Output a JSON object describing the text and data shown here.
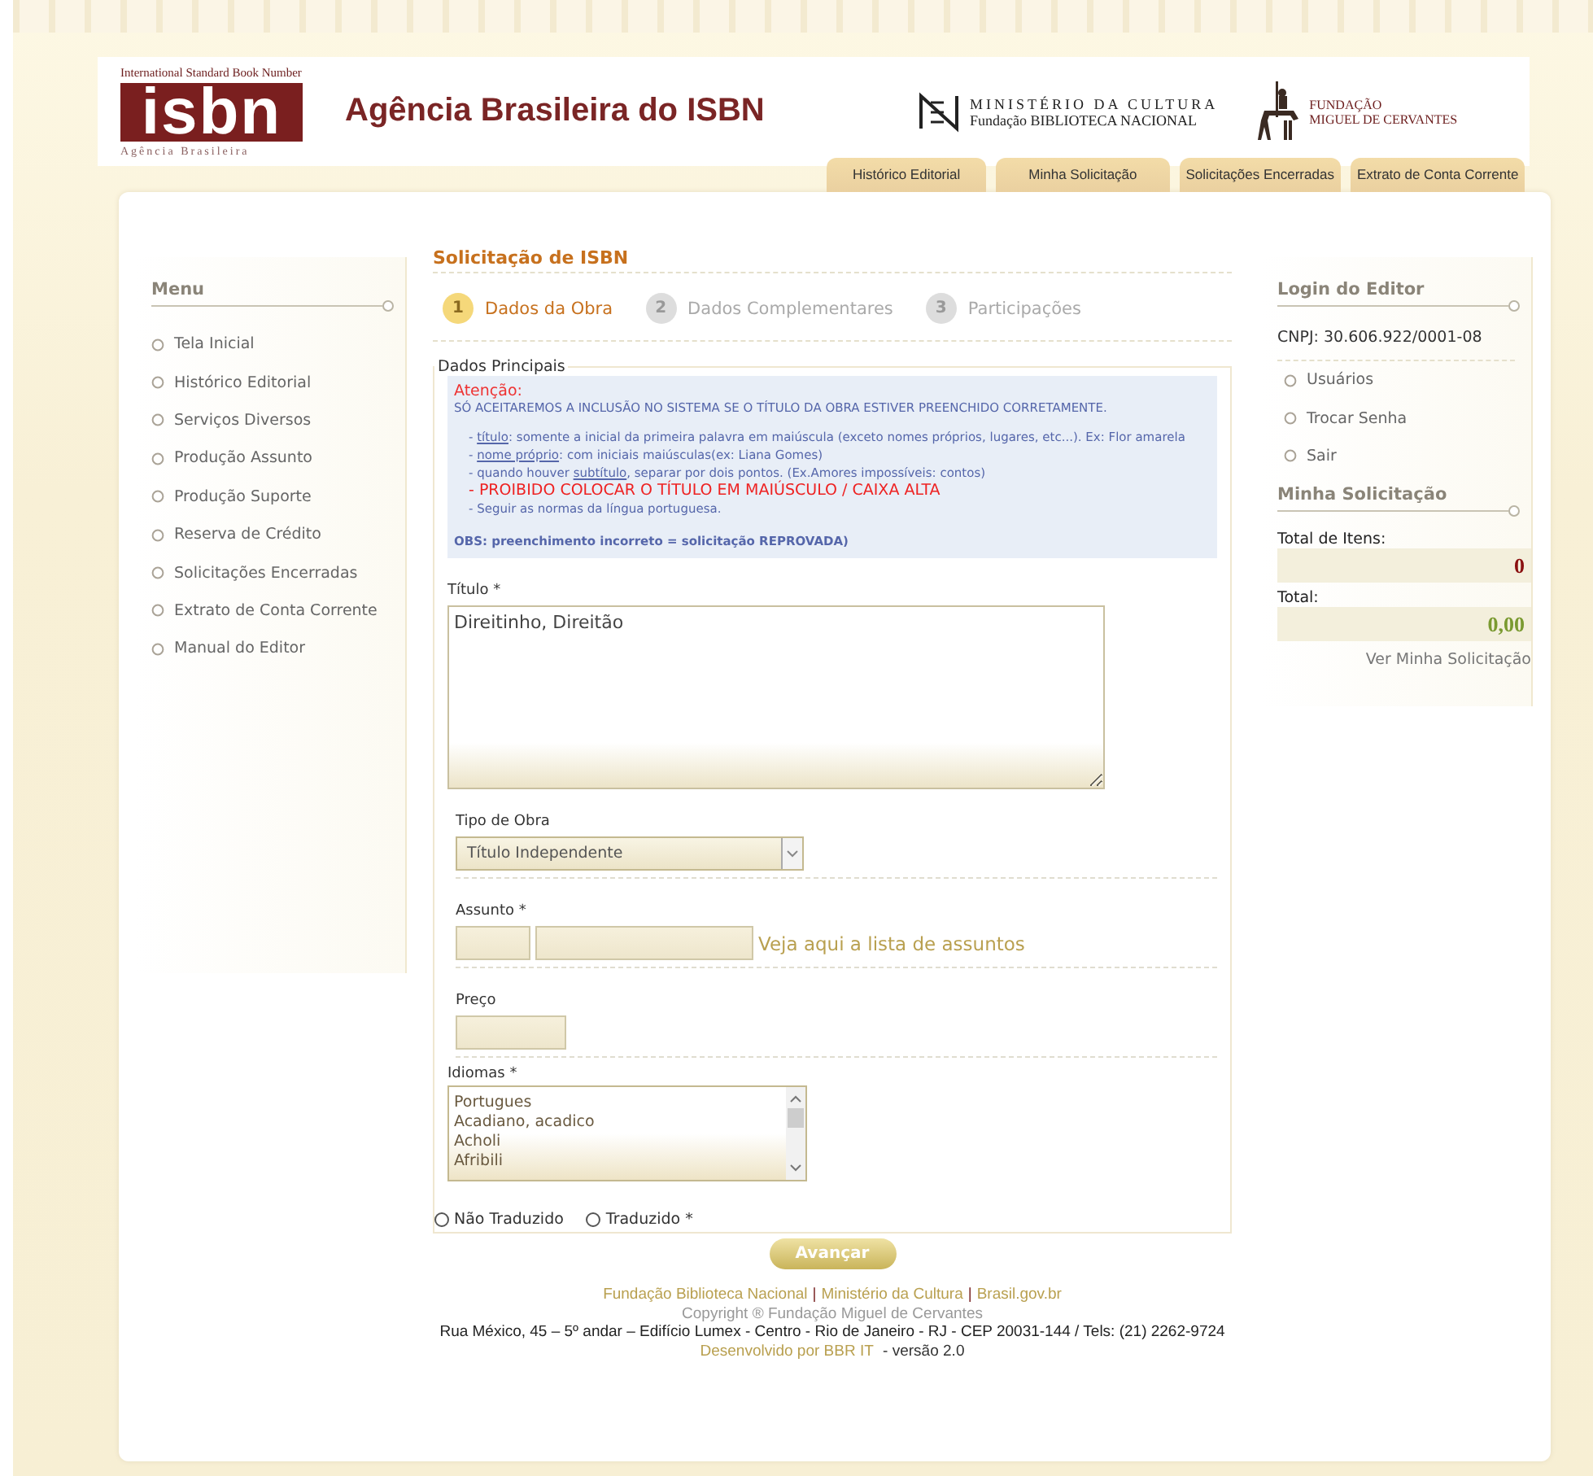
{
  "header": {
    "logo_top": "International Standard Book Number",
    "logo_mark": "isbn",
    "logo_bottom": "Agência Brasileira",
    "title": "Agência Brasileira do ISBN",
    "ministry_line1": "MINISTÉRIO DA CULTURA",
    "ministry_line2": "Fundação BIBLIOTECA NACIONAL",
    "foundation_line1": "FUNDAÇÃO",
    "foundation_line2": "MIGUEL DE CERVANTES"
  },
  "top_tabs": [
    {
      "label": "Histórico Editorial"
    },
    {
      "label": "Minha Solicitação"
    },
    {
      "label": "Solicitações Encerradas"
    },
    {
      "label": "Extrato de Conta Corrente"
    }
  ],
  "menu": {
    "title": "Menu",
    "items": [
      {
        "label": "Tela Inicial"
      },
      {
        "label": "Histórico Editorial"
      },
      {
        "label": "Serviços Diversos"
      },
      {
        "label": "Produção Assunto"
      },
      {
        "label": "Produção Suporte"
      },
      {
        "label": "Reserva de Crédito"
      },
      {
        "label": "Solicitações Encerradas"
      },
      {
        "label": "Extrato de Conta Corrente"
      },
      {
        "label": "Manual do Editor"
      }
    ]
  },
  "main": {
    "title": "Solicitação de ISBN",
    "steps": [
      {
        "number": "1",
        "label": "Dados da Obra",
        "selected": true
      },
      {
        "number": "2",
        "label": "Dados Complementares",
        "selected": false
      },
      {
        "number": "3",
        "label": "Participações",
        "selected": false
      }
    ],
    "fieldset": "Dados Principais",
    "notice": {
      "heading": "Atenção:",
      "lead": "SÓ ACEITAREMOS A INCLUSÃO NO SISTEMA SE O TÍTULO DA OBRA ESTIVER PREENCHIDO CORRETAMENTE.",
      "lines": [
        {
          "kind": "normal",
          "parts": [
            {
              "text": "- ",
              "underline": false
            },
            {
              "text": "título",
              "underline": true
            },
            {
              "text": ": somente a inicial da primeira palavra em maiúscula (exceto nomes próprios, lugares, etc...). Ex: Flor amarela",
              "underline": false
            }
          ]
        },
        {
          "kind": "normal",
          "parts": [
            {
              "text": "- ",
              "underline": false
            },
            {
              "text": "nome próprio",
              "underline": true
            },
            {
              "text": ": com iniciais maiúsculas(ex: Liana Gomes)",
              "underline": false
            }
          ]
        },
        {
          "kind": "normal",
          "parts": [
            {
              "text": "- quando houver ",
              "underline": false
            },
            {
              "text": "subtítulo",
              "underline": true
            },
            {
              "text": ", separar por dois pontos. (Ex.Amores impossíveis: contos)",
              "underline": false
            }
          ]
        },
        {
          "kind": "warning",
          "parts": [
            {
              "text": "- PROIBIDO COLOCAR O TÍTULO EM MAIÚSCULO / CAIXA ALTA",
              "underline": false
            }
          ]
        },
        {
          "kind": "normal",
          "parts": [
            {
              "text": "- Seguir as normas da língua portuguesa.",
              "underline": false
            }
          ]
        }
      ],
      "obs": "OBS: preenchimento incorreto = solicitação REPROVADA)"
    },
    "title_label": "Título *",
    "title_value": "Direitinho, Direitão",
    "type_label": "Tipo de Obra",
    "type_value": "Título Independente",
    "subject_label": "Assunto *",
    "subject_link": "Veja aqui a lista de assuntos",
    "price_label": "Preço",
    "languages_label": "Idiomas *",
    "languages": [
      "Portugues",
      "Acadiano, acadico",
      "Acholi",
      "Afribili"
    ],
    "translation": [
      {
        "label": "Não Traduzido",
        "selected": false
      },
      {
        "label": "Traduzido *",
        "selected": false
      }
    ],
    "next_button": "Avançar"
  },
  "login": {
    "title": "Login do Editor",
    "cnpj": "CNPJ: 30.606.922/0001-08",
    "items": [
      {
        "label": "Usuários"
      },
      {
        "label": "Trocar Senha"
      },
      {
        "label": "Sair"
      }
    ]
  },
  "request": {
    "title": "Minha Solicitação",
    "items_label": "Total de Itens:",
    "items_value": "0",
    "total_label": "Total:",
    "total_value": "0,00",
    "link": "Ver Minha Solicitação"
  },
  "footer": {
    "separator": "|",
    "links": [
      "Fundação Biblioteca Nacional",
      "Ministério da Cultura",
      "Brasil.gov.br"
    ],
    "copyright": "Copyright ® Fundação Miguel de Cervantes",
    "address": "Rua México, 45 – 5º andar – Edifício Lumex - Centro - Rio de Janeiro - RJ - CEP 20031-144 / Tels: (21) 2262-9724",
    "dev_link": "Desenvolvido por BBR IT",
    "version": " - versão 2.0"
  }
}
